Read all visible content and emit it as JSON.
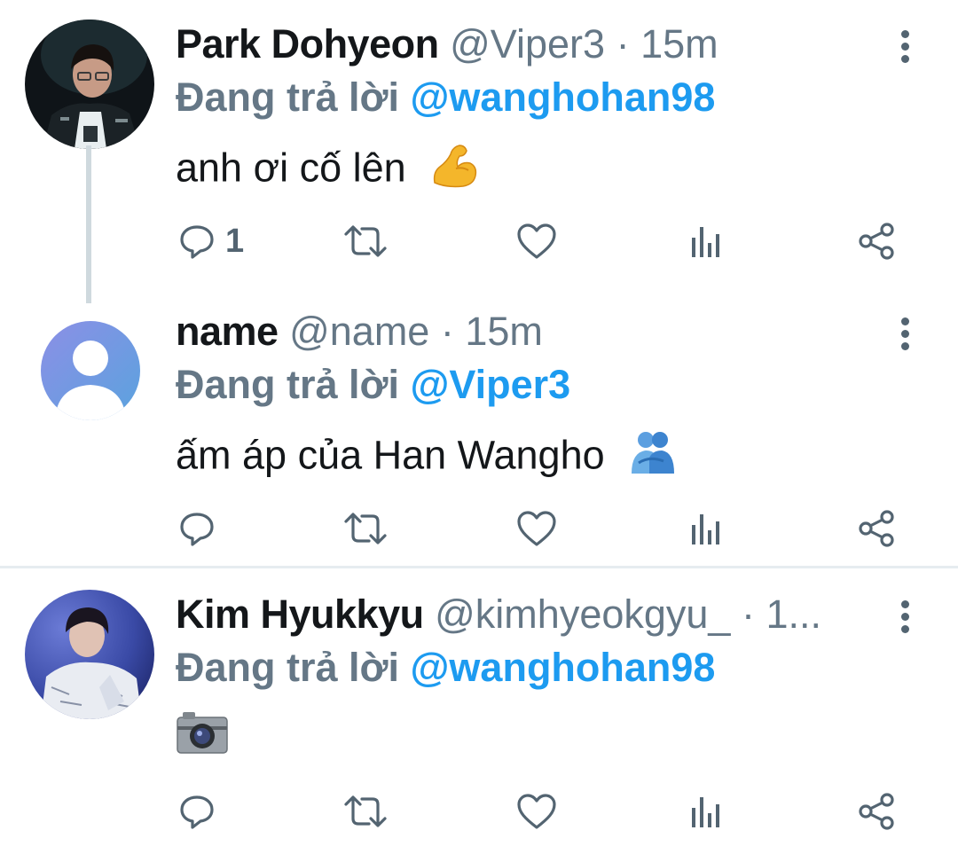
{
  "tweets": [
    {
      "name": "Park Dohyeon",
      "handle": "@Viper3",
      "sep": "·",
      "time": "15m",
      "reply_prefix": "Đang trả lời",
      "reply_to": "@wanghohan98",
      "text": "anh ơi cố lên",
      "emoji_icon": "flexed-biceps-icon",
      "reply_count": "1"
    },
    {
      "name": "name",
      "handle": "@name",
      "sep": "·",
      "time": "15m",
      "reply_prefix": "Đang trả lời",
      "reply_to": "@Viper3",
      "text": "ấm áp của Han Wangho",
      "emoji_icon": "people-hugging-icon",
      "reply_count": ""
    },
    {
      "name": "Kim Hyukkyu",
      "handle": "@kimhyeokgyu_",
      "sep": "·",
      "time": "1...",
      "reply_prefix": "Đang trả lời",
      "reply_to": "@wanghohan98",
      "text": "",
      "emoji_icon": "camera-icon",
      "reply_count": ""
    }
  ],
  "colors": {
    "link": "#1d9bf0",
    "secondary_text": "#657786",
    "icon": "#536471",
    "thread_line": "#cfd9de"
  }
}
